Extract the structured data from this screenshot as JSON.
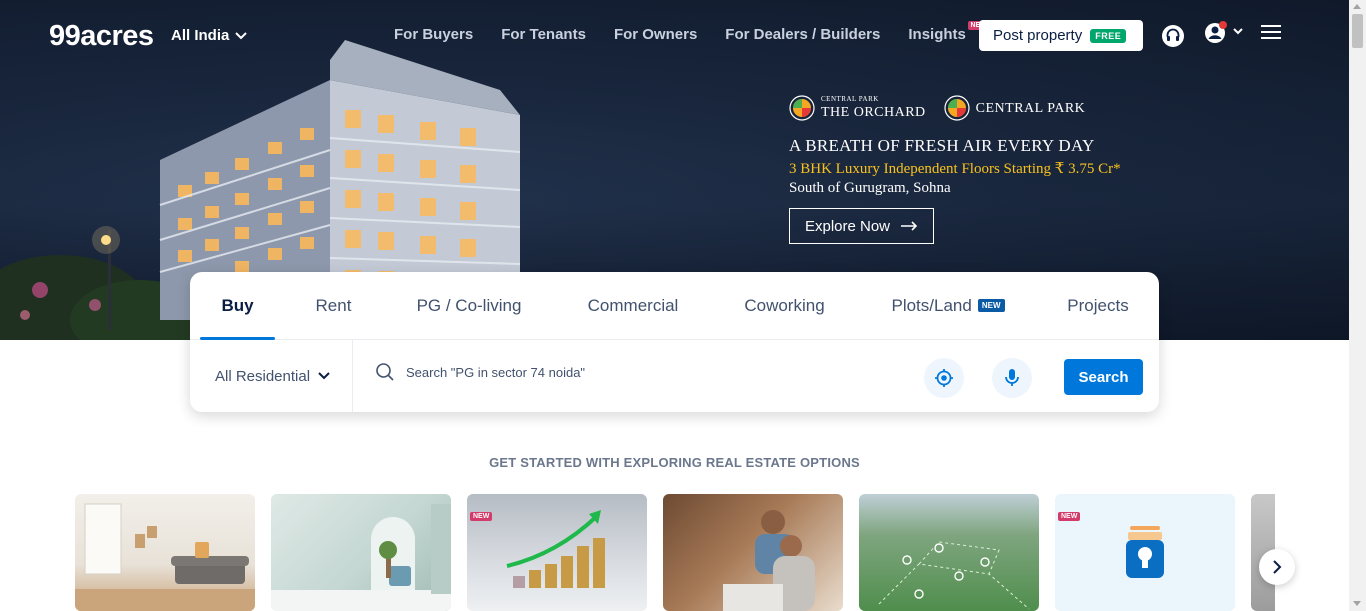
{
  "header": {
    "logo": "99acres",
    "region": "All India",
    "nav": [
      {
        "label": "For Buyers",
        "badge": ""
      },
      {
        "label": "For Tenants",
        "badge": ""
      },
      {
        "label": "For Owners",
        "badge": ""
      },
      {
        "label": "For Dealers / Builders",
        "badge": ""
      },
      {
        "label": "Insights",
        "badge": "NEW"
      }
    ],
    "post_property": "Post property",
    "post_property_badge": "FREE"
  },
  "ad": {
    "brand1_small": "CENTRAL PARK",
    "brand1_big": "THE ORCHARD",
    "brand2": "CENTRAL PARK",
    "headline": "A BREATH OF FRESH AIR EVERY DAY",
    "offer": "3 BHK Luxury Independent Floors Starting ₹ 3.75 Cr*",
    "location": "South of Gurugram, Sohna",
    "cta": "Explore Now"
  },
  "search": {
    "tabs": [
      {
        "label": "Buy",
        "badge": ""
      },
      {
        "label": "Rent",
        "badge": ""
      },
      {
        "label": "PG / Co-living",
        "badge": ""
      },
      {
        "label": "Commercial",
        "badge": ""
      },
      {
        "label": "Coworking",
        "badge": ""
      },
      {
        "label": "Plots/Land",
        "badge": "NEW"
      },
      {
        "label": "Projects",
        "badge": ""
      }
    ],
    "active_tab": "Buy",
    "property_type": "All Residential",
    "placeholder": "Search \"PG in sector 74 noida\"",
    "button": "Search"
  },
  "explore": {
    "title": "GET STARTED WITH EXPLORING REAL ESTATE OPTIONS",
    "card_badge": "NEW"
  },
  "colors": {
    "accent": "#0078db",
    "free_badge": "#00a66c",
    "new_badge": "#d33b6a",
    "offer_text": "#f8c21e"
  }
}
